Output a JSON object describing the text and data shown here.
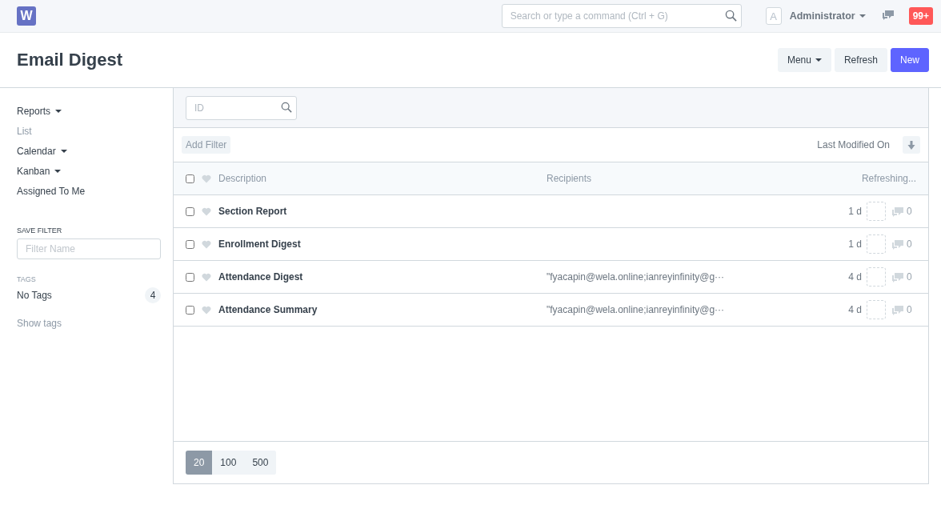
{
  "navbar": {
    "logo": "W",
    "search": {
      "placeholder": "Search or type a command (Ctrl + G)"
    },
    "avatar": "A",
    "user": "Administrator",
    "notifications": "99+"
  },
  "page": {
    "title": "Email Digest",
    "buttons": [
      {
        "label": "Menu",
        "kind": "dropdown"
      },
      {
        "label": "Refresh",
        "kind": "default"
      },
      {
        "label": "New",
        "kind": "primary"
      }
    ]
  },
  "sidebar": {
    "views": [
      {
        "label": "Reports",
        "dropdown": true,
        "selected": false
      },
      {
        "label": "List",
        "dropdown": false,
        "selected": true
      },
      {
        "label": "Calendar",
        "dropdown": true,
        "selected": false
      },
      {
        "label": "Kanban",
        "dropdown": true,
        "selected": false
      },
      {
        "label": "Assigned To Me",
        "dropdown": false,
        "selected": false
      }
    ],
    "save_filter": {
      "heading": "SAVE FILTER",
      "placeholder": "Filter Name"
    },
    "tags": {
      "heading": "TAGS",
      "items": [
        {
          "label": "No Tags",
          "count": "4"
        }
      ],
      "show_tags": "Show tags"
    }
  },
  "list": {
    "id_filter": {
      "placeholder": "ID"
    },
    "add_filter": "Add Filter",
    "sort": "Last Modified On",
    "select_all": {
      "checked": false
    },
    "columns": [
      "Description",
      "Recipients",
      "Refreshing..."
    ],
    "rows": [
      {
        "checked": false,
        "description": "Section Report",
        "recipients": "",
        "modified": "1 d",
        "comments": "0"
      },
      {
        "checked": false,
        "description": "Enrollment Digest",
        "recipients": "",
        "modified": "1 d",
        "comments": "0"
      },
      {
        "checked": false,
        "description": "Attendance Digest",
        "recipients": "\"fyacapin@wela.online;ianreyinfinity@g···",
        "modified": "4 d",
        "comments": "0"
      },
      {
        "checked": false,
        "description": "Attendance Summary",
        "recipients": "\"fyacapin@wela.online;ianreyinfinity@g···",
        "modified": "4 d",
        "comments": "0"
      }
    ],
    "page_sizes": [
      {
        "label": "20",
        "selected": true
      },
      {
        "label": "100",
        "selected": false
      },
      {
        "label": "500",
        "selected": false
      }
    ]
  }
}
